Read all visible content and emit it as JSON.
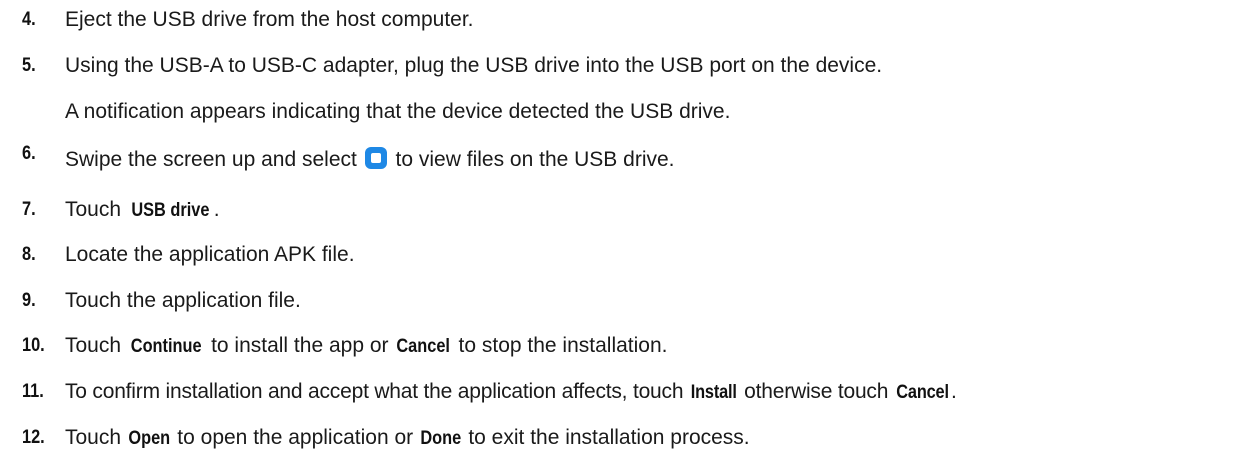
{
  "steps": [
    {
      "num": "4.",
      "text": "Eject the USB drive from the host computer."
    },
    {
      "num": "5.",
      "text": "Using the USB-A to USB-C adapter, plug the USB drive into the USB port on the device.",
      "note": "A notification appears indicating that the device detected the USB drive."
    },
    {
      "num": "6.",
      "text_before": "Swipe the screen up and select",
      "icon": "files-app-icon",
      "text_after": "to view files on the USB drive."
    },
    {
      "num": "7.",
      "text_before": "Touch",
      "bold": "USB drive",
      "text_after": "."
    },
    {
      "num": "8.",
      "text": "Locate the application APK file."
    },
    {
      "num": "9.",
      "text": "Touch the application file."
    },
    {
      "num": "10.",
      "text_before": "Touch",
      "bold1": "Continue",
      "text_mid": "to install the app or",
      "bold2": "Cancel",
      "text_after": "to stop the installation."
    },
    {
      "num": "11.",
      "text_before": "To confirm installation and accept what the application affects, touch",
      "bold1": "Install",
      "text_mid": "otherwise touch",
      "bold2": "Cancel",
      "text_after": "."
    },
    {
      "num": "12.",
      "text_before": "Touch",
      "bold1": "Open",
      "text_mid": "to open the application or",
      "bold2": "Done",
      "text_after": "to exit the installation process."
    }
  ],
  "colors": {
    "text": "#1a1a1a",
    "icon_blue": "#1e88e5"
  }
}
